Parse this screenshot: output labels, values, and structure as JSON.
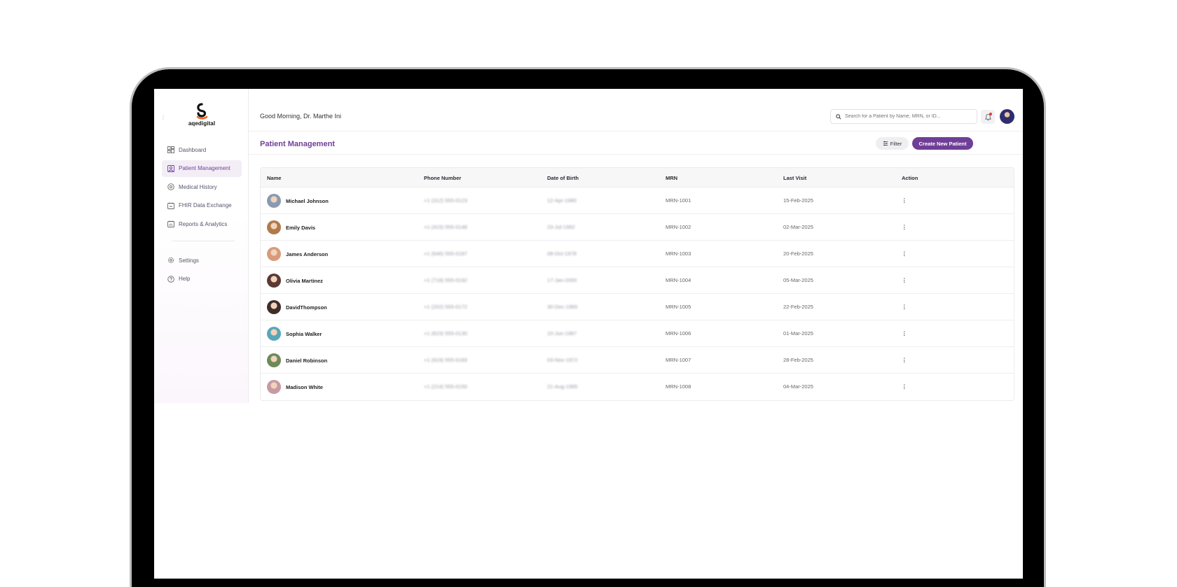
{
  "brand": {
    "logo_text": "aqedigital"
  },
  "header": {
    "greeting": "Good Morning, Dr. Marthe Ini",
    "search_placeholder": "Search for a Patient by Name, MRN, or ID..."
  },
  "sidebar": {
    "items": [
      {
        "label": "Dashboard",
        "icon": "dashboard-icon"
      },
      {
        "label": "Patient Management",
        "icon": "patient-icon",
        "active": true
      },
      {
        "label": "Medical History",
        "icon": "history-icon"
      },
      {
        "label": "FHIR Data Exchange",
        "icon": "exchange-icon"
      },
      {
        "label": "Reports & Analytics",
        "icon": "reports-icon"
      }
    ],
    "secondary": [
      {
        "label": "Settings",
        "icon": "gear-icon"
      },
      {
        "label": "Help",
        "icon": "help-icon"
      }
    ]
  },
  "page": {
    "title": "Patient Management",
    "filter_label": "Filter",
    "create_label": "Create New Patient"
  },
  "table": {
    "columns": [
      "Name",
      "Phone Number",
      "Date of Birth",
      "MRN",
      "Last Visit",
      "Action"
    ],
    "rows": [
      {
        "name": "Michael Johnson",
        "phone": "+1 (312) 555-0123",
        "dob": "12-Apr-1980",
        "mrn": "MRN-1001",
        "last_visit": "15-Feb-2025",
        "action": "⋮",
        "avatar_color": "#8a9bb0"
      },
      {
        "name": "Emily Davis",
        "phone": "+1 (415) 555-0148",
        "dob": "23-Jul-1992",
        "mrn": "MRN-1002",
        "last_visit": "02-Mar-2025",
        "action": "⋮",
        "avatar_color": "#b07a4a"
      },
      {
        "name": "James Anderson",
        "phone": "+1 (646) 555-0187",
        "dob": "08-Oct-1978",
        "mrn": "MRN-1003",
        "last_visit": "20-Feb-2025",
        "action": "⋮",
        "avatar_color": "#d99a7a"
      },
      {
        "name": "Olivia Martinez",
        "phone": "+1 (718) 555-0192",
        "dob": "17-Jan-2000",
        "mrn": "MRN-1004",
        "last_visit": "05-Mar-2025",
        "action": "⋮",
        "avatar_color": "#5a3a33"
      },
      {
        "name": "DavidThompson",
        "phone": "+1 (202) 555-0172",
        "dob": "30-Dec-1965",
        "mrn": "MRN-1005",
        "last_visit": "22-Feb-2025",
        "action": "⋮",
        "avatar_color": "#3e2d28"
      },
      {
        "name": "Sophia Walker",
        "phone": "+1 (623) 555-0130",
        "dob": "10-Jun-1987",
        "mrn": "MRN-1006",
        "last_visit": "01-Mar-2025",
        "action": "⋮",
        "avatar_color": "#5aa6b8"
      },
      {
        "name": "Daniel Robinson",
        "phone": "+1 (919) 555-0183",
        "dob": "03-Nov-1972",
        "mrn": "MRN-1007",
        "last_visit": "28-Feb-2025",
        "action": "⋮",
        "avatar_color": "#6d8a5a"
      },
      {
        "name": "Madison White",
        "phone": "+1 (214) 555-0150",
        "dob": "21-Aug-1995",
        "mrn": "MRN-1008",
        "last_visit": "04-Mar-2025",
        "action": "⋮",
        "avatar_color": "#c79aa2"
      }
    ]
  }
}
